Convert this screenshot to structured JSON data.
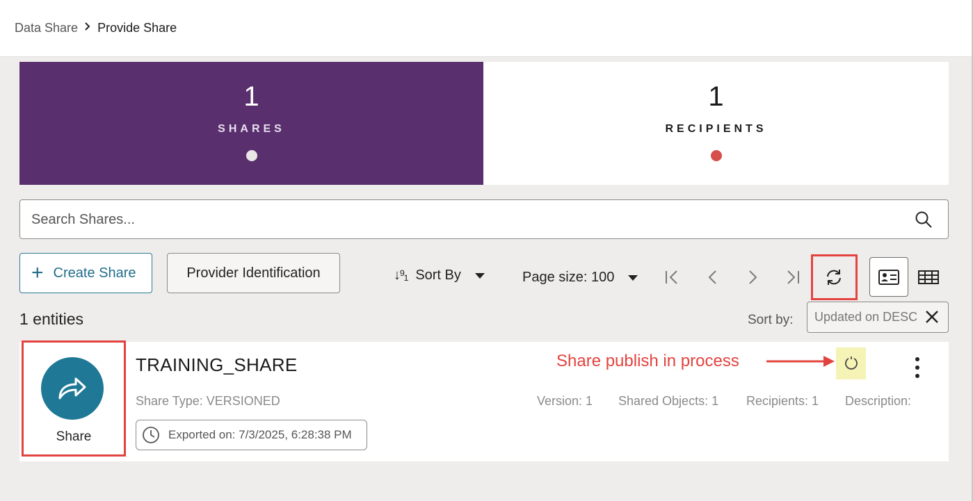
{
  "breadcrumb": {
    "parent": "Data Share",
    "current": "Provide Share"
  },
  "tiles": [
    {
      "count": "1",
      "label": "SHARES"
    },
    {
      "count": "1",
      "label": "RECIPIENTS"
    }
  ],
  "colors": {
    "shares_tile": "#59306d",
    "accent": "#1f7896",
    "highlight": "#e3433f",
    "status_bg": "#f5f3b5"
  },
  "search": {
    "placeholder": "Search Shares..."
  },
  "toolbar": {
    "create_label": "Create Share",
    "provider_label": "Provider Identification",
    "sort_label": "Sort By",
    "page_size_label": "Page size: 100"
  },
  "results": {
    "count_label": "1 entities",
    "sort_by_label": "Sort by:",
    "sort_chip": "Updated on DESC"
  },
  "share": {
    "icon_label": "Share",
    "name": "TRAINING_SHARE",
    "type": "Share Type: VERSIONED",
    "exported": "Exported on: 7/3/2025, 6:28:38 PM",
    "version": "Version: 1",
    "shared_objects": "Shared Objects: 1",
    "recipients": "Recipients: 1",
    "description": "Description:"
  },
  "annotation": {
    "text": "Share publish in process"
  }
}
